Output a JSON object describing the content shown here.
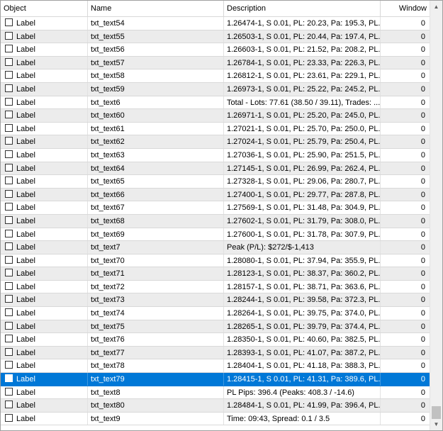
{
  "columns": {
    "object": "Object",
    "name": "Name",
    "description": "Description",
    "window": "Window"
  },
  "rows": [
    {
      "object": "Label",
      "name": "txt_text54",
      "description": "1.26474-1, S 0.01, PL: 20.23, Pa: 195.3, PL...",
      "window": "0"
    },
    {
      "object": "Label",
      "name": "txt_text55",
      "description": "1.26503-1, S 0.01, PL: 20.44, Pa: 197.4, PL...",
      "window": "0"
    },
    {
      "object": "Label",
      "name": "txt_text56",
      "description": "1.26603-1, S 0.01, PL: 21.52, Pa: 208.2, PL...",
      "window": "0"
    },
    {
      "object": "Label",
      "name": "txt_text57",
      "description": "1.26784-1, S 0.01, PL: 23.33, Pa: 226.3, PL...",
      "window": "0"
    },
    {
      "object": "Label",
      "name": "txt_text58",
      "description": "1.26812-1, S 0.01, PL: 23.61, Pa: 229.1, PL...",
      "window": "0"
    },
    {
      "object": "Label",
      "name": "txt_text59",
      "description": "1.26973-1, S 0.01, PL: 25.22, Pa: 245.2, PL...",
      "window": "0"
    },
    {
      "object": "Label",
      "name": "txt_text6",
      "description": "Total - Lots: 77.61 (38.50 / 39.11), Trades: ...",
      "window": "0"
    },
    {
      "object": "Label",
      "name": "txt_text60",
      "description": "1.26971-1, S 0.01, PL: 25.20, Pa: 245.0, PL...",
      "window": "0"
    },
    {
      "object": "Label",
      "name": "txt_text61",
      "description": "1.27021-1, S 0.01, PL: 25.70, Pa: 250.0, PL...",
      "window": "0"
    },
    {
      "object": "Label",
      "name": "txt_text62",
      "description": "1.27024-1, S 0.01, PL: 25.79, Pa: 250.4, PL...",
      "window": "0"
    },
    {
      "object": "Label",
      "name": "txt_text63",
      "description": "1.27036-1, S 0.01, PL: 25.90, Pa: 251.5, PL...",
      "window": "0"
    },
    {
      "object": "Label",
      "name": "txt_text64",
      "description": "1.27145-1, S 0.01, PL: 26.99, Pa: 262.4, PL...",
      "window": "0"
    },
    {
      "object": "Label",
      "name": "txt_text65",
      "description": "1.27328-1, S 0.01, PL: 29.06, Pa: 280.7, PL...",
      "window": "0"
    },
    {
      "object": "Label",
      "name": "txt_text66",
      "description": "1.27400-1, S 0.01, PL: 29.77, Pa: 287.8, PL...",
      "window": "0"
    },
    {
      "object": "Label",
      "name": "txt_text67",
      "description": "1.27569-1, S 0.01, PL: 31.48, Pa: 304.9, PL...",
      "window": "0"
    },
    {
      "object": "Label",
      "name": "txt_text68",
      "description": "1.27602-1, S 0.01, PL: 31.79, Pa: 308.0, PL...",
      "window": "0"
    },
    {
      "object": "Label",
      "name": "txt_text69",
      "description": "1.27600-1, S 0.01, PL: 31.78, Pa: 307.9, PL...",
      "window": "0"
    },
    {
      "object": "Label",
      "name": "txt_text7",
      "description": "Peak (P/L): $272/$-1,413",
      "window": "0"
    },
    {
      "object": "Label",
      "name": "txt_text70",
      "description": "1.28080-1, S 0.01, PL: 37.94, Pa: 355.9, PL...",
      "window": "0"
    },
    {
      "object": "Label",
      "name": "txt_text71",
      "description": "1.28123-1, S 0.01, PL: 38.37, Pa: 360.2, PL...",
      "window": "0"
    },
    {
      "object": "Label",
      "name": "txt_text72",
      "description": "1.28157-1, S 0.01, PL: 38.71, Pa: 363.6, PL...",
      "window": "0"
    },
    {
      "object": "Label",
      "name": "txt_text73",
      "description": "1.28244-1, S 0.01, PL: 39.58, Pa: 372.3, PL...",
      "window": "0"
    },
    {
      "object": "Label",
      "name": "txt_text74",
      "description": "1.28264-1, S 0.01, PL: 39.75, Pa: 374.0, PL...",
      "window": "0"
    },
    {
      "object": "Label",
      "name": "txt_text75",
      "description": "1.28265-1, S 0.01, PL: 39.79, Pa: 374.4, PL...",
      "window": "0"
    },
    {
      "object": "Label",
      "name": "txt_text76",
      "description": "1.28350-1, S 0.01, PL: 40.60, Pa: 382.5, PL...",
      "window": "0"
    },
    {
      "object": "Label",
      "name": "txt_text77",
      "description": "1.28393-1, S 0.01, PL: 41.07, Pa: 387.2, PL...",
      "window": "0"
    },
    {
      "object": "Label",
      "name": "txt_text78",
      "description": "1.28404-1, S 0.01, PL: 41.18, Pa: 388.3, PL...",
      "window": "0"
    },
    {
      "object": "Label",
      "name": "txt_text79",
      "description": "1.28415-1, S 0.01, PL: 41.31, Pa: 389.6, PL...",
      "window": "0",
      "selected": true
    },
    {
      "object": "Label",
      "name": "txt_text8",
      "description": "PL Pips: 396.4 (Peaks: 408.3 / -14.6)",
      "window": "0"
    },
    {
      "object": "Label",
      "name": "txt_text80",
      "description": "1.28484-1, S 0.01, PL: 41.99, Pa: 396.4, PL...",
      "window": "0"
    },
    {
      "object": "Label",
      "name": "txt_text9",
      "description": "Time: 09:43, Spread: 0.1 / 3.5",
      "window": "0"
    }
  ],
  "colors": {
    "selected_row": "#0078d7",
    "alt_row": "#ececec"
  },
  "icons": {
    "scroll_up": "▲",
    "scroll_down": "▼"
  }
}
